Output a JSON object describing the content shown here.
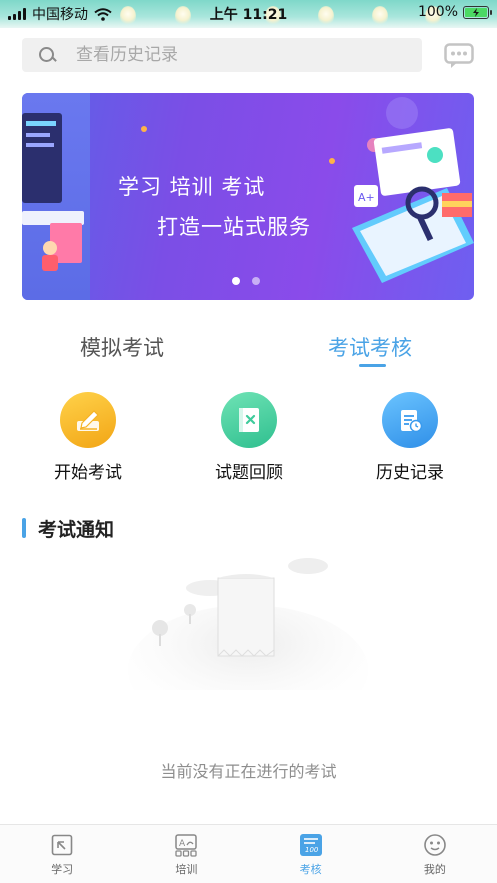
{
  "status_bar": {
    "carrier": "中国移动",
    "time": "上午 11:21",
    "battery": "100%"
  },
  "search": {
    "placeholder": "查看历史记录"
  },
  "banner": {
    "line1": "学习 培训 考试",
    "line2": "打造一站式服务",
    "slide_count": 2,
    "active_slide": 1
  },
  "tabs": [
    {
      "label": "模拟考试",
      "active": false
    },
    {
      "label": "考试考核",
      "active": true
    }
  ],
  "features": [
    {
      "label": "开始考试",
      "icon": "pen-icon",
      "color": "#f5b324"
    },
    {
      "label": "试题回顾",
      "icon": "book-x-icon",
      "color": "#3fcb9b"
    },
    {
      "label": "历史记录",
      "icon": "history-doc-icon",
      "color": "#3a9bee"
    }
  ],
  "section": {
    "title": "考试通知",
    "empty_text": "当前没有正在进行的考试"
  },
  "bottom_nav": [
    {
      "label": "学习",
      "icon": "study-icon",
      "active": false
    },
    {
      "label": "培训",
      "icon": "training-icon",
      "active": false
    },
    {
      "label": "考核",
      "icon": "exam-icon",
      "active": true
    },
    {
      "label": "我的",
      "icon": "profile-icon",
      "active": false
    }
  ],
  "colors": {
    "accent": "#4aa3e6",
    "banner_purple": "#7b4ee6"
  }
}
